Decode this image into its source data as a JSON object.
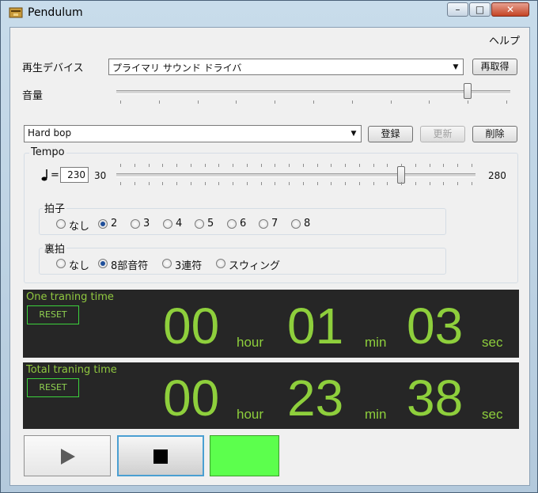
{
  "window": {
    "title": "Pendulum",
    "buttons": {
      "minimize": "–",
      "maximize": "□",
      "close": "✕"
    }
  },
  "menu": {
    "help": "ヘルプ"
  },
  "device": {
    "label": "再生デバイス",
    "selected": "プライマリ サウンド ドライバ",
    "refresh_label": "再取得"
  },
  "volume": {
    "label": "音量",
    "level_fraction": 0.9
  },
  "preset": {
    "selected": "Hard bop",
    "register_label": "登録",
    "update_label": "更新",
    "delete_label": "削除"
  },
  "tempo": {
    "group_label": "Tempo",
    "equals": "=",
    "value": "230",
    "min_label": "30",
    "max_label": "280",
    "min": 30,
    "max": 280,
    "current": 230
  },
  "beat": {
    "group_label": "拍子",
    "options": [
      "なし",
      "2",
      "3",
      "4",
      "5",
      "6",
      "7",
      "8"
    ],
    "selected_index": 1
  },
  "backbeat": {
    "group_label": "裏拍",
    "options": [
      "なし",
      "8部音符",
      "3連符",
      "スウィング"
    ],
    "selected_index": 1
  },
  "timers": [
    {
      "title": "One traning time",
      "reset_label": "RESET",
      "hours": "00",
      "minutes": "01",
      "seconds": "03",
      "hour_unit": "hour",
      "min_unit": "min",
      "sec_unit": "sec"
    },
    {
      "title": "Total traning time",
      "reset_label": "RESET",
      "hours": "00",
      "minutes": "23",
      "seconds": "38",
      "hour_unit": "hour",
      "min_unit": "min",
      "sec_unit": "sec"
    }
  ],
  "controls": {
    "play_icon": "play-icon",
    "stop_icon": "stop-icon",
    "indicator_color": "#5cff4d"
  }
}
